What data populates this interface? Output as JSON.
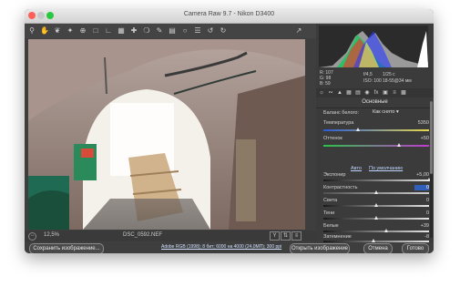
{
  "window": {
    "title": "Camera Raw 9.7  -  Nikon D3400"
  },
  "toolbar": {
    "tools": [
      "zoom-icon",
      "hand-icon",
      "white-balance-icon",
      "color-sampler-icon",
      "targeted-adjust-icon",
      "crop-icon",
      "straighten-icon",
      "transform-icon",
      "spot-removal-icon",
      "red-eye-icon",
      "adjustment-brush-icon",
      "graduated-filter-icon",
      "radial-filter-icon",
      "preferences-icon",
      "rotate-left-icon",
      "rotate-right-icon"
    ],
    "right_tool": "fullscreen-icon"
  },
  "status": {
    "zoom": "12,5%",
    "file": "DSC_0592.NEF"
  },
  "histogram": {
    "r": "R:  107",
    "g": "G:   98",
    "b": "B:   59",
    "aperture": "f/4,5",
    "shutter": "1/25 с",
    "iso": "ISO: 100",
    "lens": "18-55@34 мм"
  },
  "panel": {
    "section_title": "Основные",
    "white_balance_label": "Баланс белого:",
    "white_balance_value": "Как снято",
    "temperature_label": "Температура",
    "temperature_value": "5350",
    "tint_label": "Оттенок",
    "tint_value": "+50",
    "auto_link": "Авто",
    "default_link": "По умолчанию",
    "exposure_label": "Экспонир",
    "exposure_value": "+5,00",
    "contrast_label": "Контрастность",
    "contrast_value": "0",
    "highlights_label": "Света",
    "highlights_value": "0",
    "shadows_label": "Тени",
    "shadows_value": "0",
    "whites_label": "Белые",
    "whites_value": "+39",
    "blacks_label": "Затемнение",
    "blacks_value": "-8"
  },
  "sliders": {
    "temperature": 0.33,
    "tint": 0.72,
    "exposure": 1.0,
    "contrast": 0.5,
    "highlights": 0.5,
    "shadows": 0.5,
    "whites": 0.6,
    "blacks": 0.48
  },
  "bottom": {
    "save_label": "Сохранить изображение...",
    "workflow_text": "Adobe RGB (1998); 8 бит; 6000 на 4000 (24,0МП); 300 ppi",
    "open_label": "Открыть изображение",
    "cancel_label": "Отмена",
    "done_label": "Готово"
  },
  "colors": {
    "window_bg": "#3e3e3e",
    "panel_bg": "#3b3b3b",
    "accent_link": "#cfe0ff"
  }
}
